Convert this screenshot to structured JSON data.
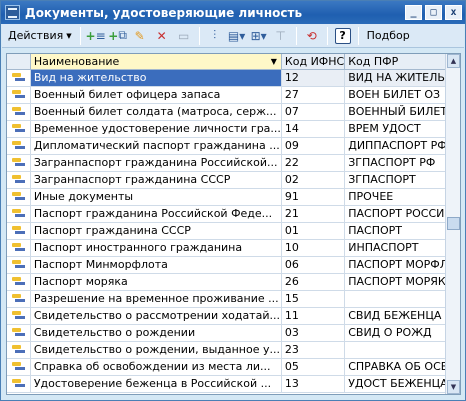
{
  "window": {
    "title": "Документы, удостоверяющие личность",
    "controls": [
      "_",
      "□",
      "x"
    ]
  },
  "toolbar": {
    "actions_label": "Действия",
    "help_label": "?",
    "select_label": "Подбор"
  },
  "grid": {
    "columns": [
      "Наименование",
      "Код ИФНС",
      "Код ПФР"
    ],
    "rows": [
      {
        "name": "Вид на жительство",
        "code": "12",
        "pfr": "ВИД НА ЖИТЕЛЬ"
      },
      {
        "name": "Военный билет офицера запаса",
        "code": "27",
        "pfr": "ВОЕН БИЛЕТ ОЗ"
      },
      {
        "name": "Военный билет солдата (матроса, серж...",
        "code": "07",
        "pfr": "ВОЕННЫЙ БИЛЕТ"
      },
      {
        "name": "Временное удостоверение личности гра...",
        "code": "14",
        "pfr": "ВРЕМ УДОСТ"
      },
      {
        "name": "Дипломатический паспорт гражданина ...",
        "code": "09",
        "pfr": "ДИППАСПОРТ РФ"
      },
      {
        "name": "Загранпаспорт гражданина Российской...",
        "code": "22",
        "pfr": "ЗГПАСПОРТ РФ"
      },
      {
        "name": "Загранпаспорт гражданина СССР",
        "code": "02",
        "pfr": "ЗГПАСПОРТ"
      },
      {
        "name": "Иные документы",
        "code": "91",
        "pfr": "ПРОЧЕЕ"
      },
      {
        "name": "Паспорт гражданина Российской Феде...",
        "code": "21",
        "pfr": "ПАСПОРТ РОССИИ"
      },
      {
        "name": "Паспорт гражданина СССР",
        "code": "01",
        "pfr": "ПАСПОРТ"
      },
      {
        "name": "Паспорт иностранного гражданина",
        "code": "10",
        "pfr": "ИНПАСПОРТ"
      },
      {
        "name": "Паспорт Минморфлота",
        "code": "06",
        "pfr": "ПАСПОРТ МОРФЛТ"
      },
      {
        "name": "Паспорт моряка",
        "code": "26",
        "pfr": "ПАСПОРТ МОРЯКА"
      },
      {
        "name": "Разрешение на временное проживание ...",
        "code": "15",
        "pfr": ""
      },
      {
        "name": "Свидетельство о рассмотрении ходатай...",
        "code": "11",
        "pfr": "СВИД БЕЖЕНЦА"
      },
      {
        "name": "Свидетельство о рождении",
        "code": "03",
        "pfr": "СВИД О РОЖД"
      },
      {
        "name": "Свидетельство о рождении, выданное у...",
        "code": "23",
        "pfr": ""
      },
      {
        "name": "Справка об освобождении из  места ли...",
        "code": "05",
        "pfr": "СПРАВКА ОБ ОСВ"
      },
      {
        "name": "Удостоверение беженца в Российской ...",
        "code": "13",
        "pfr": "УДОСТ БЕЖЕНЦА"
      }
    ]
  }
}
